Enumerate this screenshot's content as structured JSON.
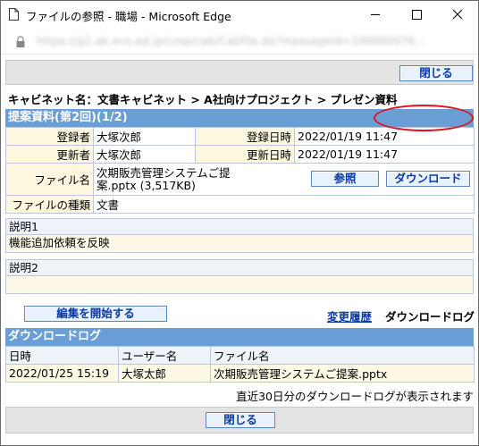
{
  "window": {
    "title": "ファイルの参照 - 職場 - Microsoft Edge",
    "url": "https://g2.ak.eco.ad.jp/cmp/cab/Cabfile.do?messageId=100000076..."
  },
  "toolbar": {
    "close_label": "閉じる"
  },
  "breadcrumb": "キャビネット名：文書キャビネット > A社向けプロジェクト > プレゼン資料",
  "file_section": {
    "header": "提案資料(第2回)(1/2)",
    "registrant_label": "登録者",
    "registrant": "大塚次郎",
    "registered_at_label": "登録日時",
    "registered_at": "2022/01/19 11:47",
    "updater_label": "更新者",
    "updater": "大塚次郎",
    "updated_at_label": "更新日時",
    "updated_at": "2022/01/19 11:47",
    "filename_label": "ファイル名",
    "filename_line1": "次期販売管理システムご提",
    "filename_line2": "案.pptx (3,517KB)",
    "browse_label": "参照",
    "download_label": "ダウンロード",
    "filetype_label": "ファイルの種類",
    "filetype": "文書"
  },
  "description1": {
    "label": "説明1",
    "text": "機能追加依頼を反映"
  },
  "description2": {
    "label": "説明2",
    "text": ""
  },
  "actions": {
    "start_edit_label": "編集を開始する",
    "history_link": "変更履歴",
    "download_log_label": "ダウンロードログ"
  },
  "download_log": {
    "header": "ダウンロードログ",
    "columns": [
      "日時",
      "ユーザー名",
      "ファイル名"
    ],
    "rows": [
      [
        "2022/01/25 15:19",
        "大塚太郎",
        "次期販売管理システムご提案.pptx"
      ]
    ],
    "note": "直近30日分のダウンロードログが表示されます"
  },
  "footer": {
    "close_label": "閉じる"
  },
  "colors": {
    "header_blue": "#6a9ed6",
    "button_text": "#0b3aa5",
    "label_cream": "#fdf7e0",
    "highlight_circle": "#e0141e"
  },
  "icons": [
    "document-icon",
    "minimize-icon",
    "maximize-icon",
    "close-icon",
    "lock-icon"
  ]
}
